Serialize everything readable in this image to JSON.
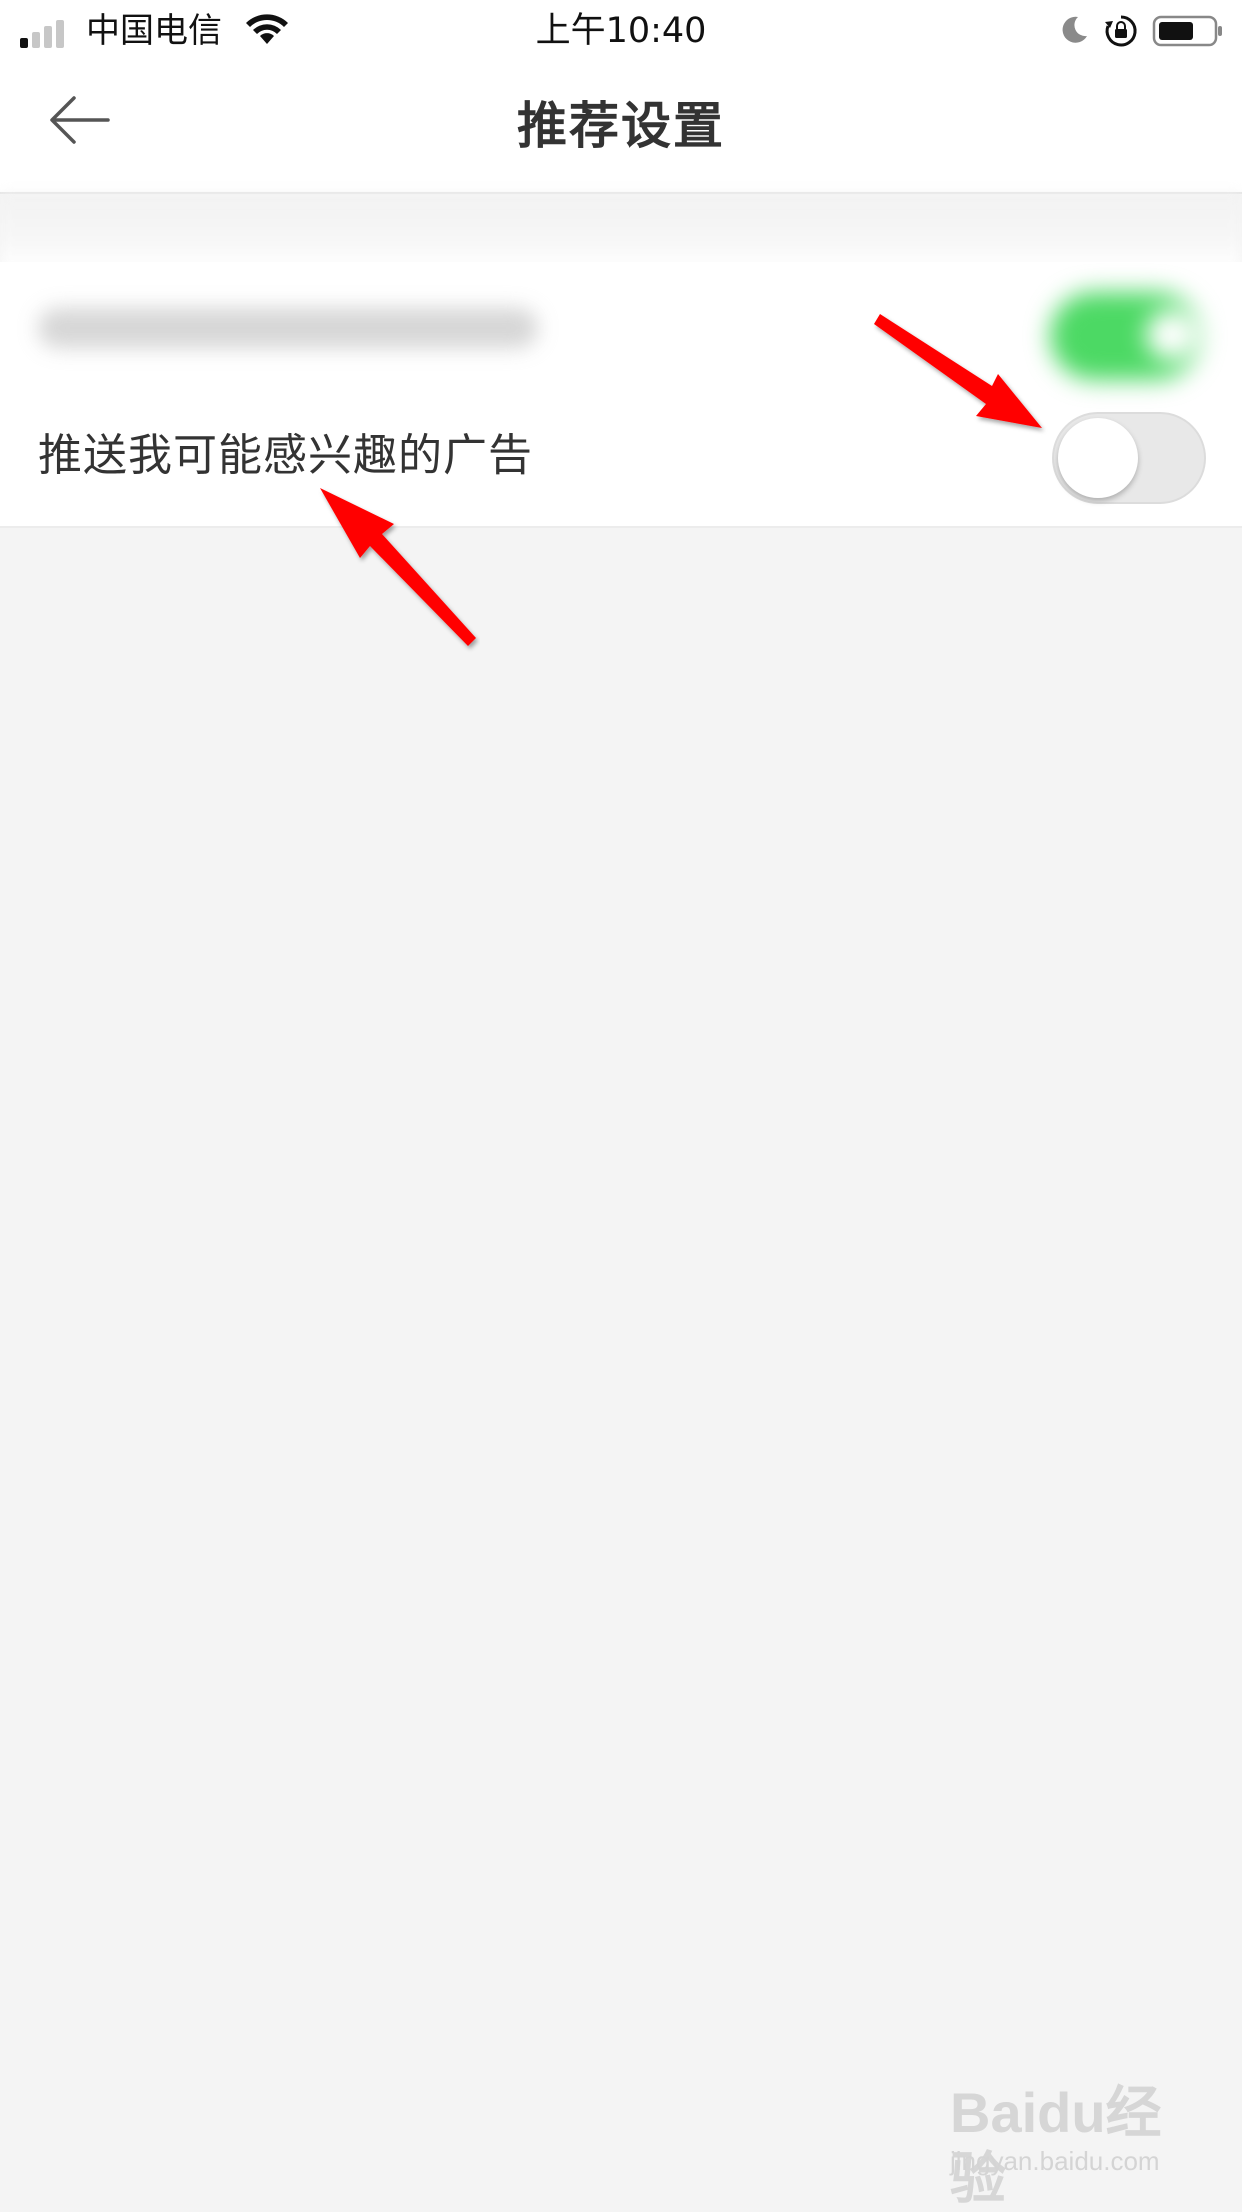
{
  "status_bar": {
    "carrier": "中国电信",
    "time": "上午10:40",
    "icons": [
      "signal-icon",
      "wifi-icon",
      "moon-icon",
      "lock-rotation-icon",
      "battery-icon"
    ]
  },
  "nav": {
    "title": "推荐设置",
    "back_icon": "back-arrow-icon"
  },
  "settings": {
    "row_1": {
      "label": "",
      "toggle_on": true,
      "blurred": true
    },
    "row_2": {
      "label": "推送我可能感兴趣的广告",
      "toggle_on": false
    }
  },
  "colors": {
    "toggle_on": "#4cd964",
    "toggle_off": "#e8e8e8",
    "annotation": "#ff0000",
    "background": "#f4f4f4"
  },
  "annotations": {
    "arrows": [
      "arrow-to-toggle",
      "arrow-to-label"
    ]
  },
  "watermark": {
    "brand": "Baidu经验",
    "url": "jingyan.baidu.com"
  }
}
